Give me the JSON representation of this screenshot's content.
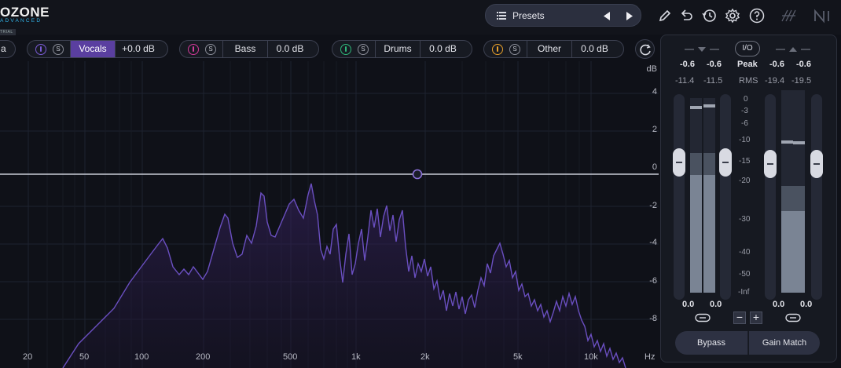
{
  "app": {
    "logo": "OZONE",
    "logo_sub": "ADVANCED",
    "logo_tag": "TRIAL"
  },
  "presets": {
    "label": "Presets",
    "icon": "list-icon"
  },
  "header_icons": [
    "pencil-icon",
    "undo-icon",
    "history-icon",
    "gear-icon",
    "help-icon",
    "ni-icon"
  ],
  "stems": {
    "partial_label": "a",
    "items": [
      {
        "name": "Vocals",
        "gain": "+0.0 dB",
        "color": "#7b5cd6"
      },
      {
        "name": "Bass",
        "gain": "0.0 dB",
        "color": "#d23a9a"
      },
      {
        "name": "Drums",
        "gain": "0.0 dB",
        "color": "#2fb87a"
      },
      {
        "name": "Other",
        "gain": "0.0 dB",
        "color": "#e8a02a"
      }
    ],
    "solo_label": "S"
  },
  "spectrum": {
    "db_unit": "dB",
    "hz_unit": "Hz",
    "db_ticks": [
      "4",
      "2",
      "0",
      "-2",
      "-4",
      "-6",
      "-8"
    ],
    "hz_ticks": [
      "20",
      "50",
      "100",
      "200",
      "500",
      "1k",
      "2k",
      "5k",
      "10k"
    ],
    "line_color": "#6a4fc0"
  },
  "meters": {
    "io_label": "I/O",
    "peak_label": "Peak",
    "rms_label": "RMS",
    "in_peak_l": "-0.6",
    "in_peak_r": "-0.6",
    "in_rms_l": "-11.4",
    "in_rms_r": "-11.5",
    "out_peak_l": "-0.6",
    "out_peak_r": "-0.6",
    "out_rms_l": "-19.4",
    "out_rms_r": "-19.5",
    "scale": [
      "0",
      "-3",
      "-6",
      "-10",
      "-15",
      "-20",
      "-30",
      "-40",
      "-50",
      "-Inf"
    ],
    "in_gain_l": "0.0",
    "in_gain_r": "0.0",
    "out_gain_l": "0.0",
    "out_gain_r": "0.0",
    "minus": "−",
    "plus": "+",
    "bypass": "Bypass",
    "gain_match": "Gain Match"
  }
}
